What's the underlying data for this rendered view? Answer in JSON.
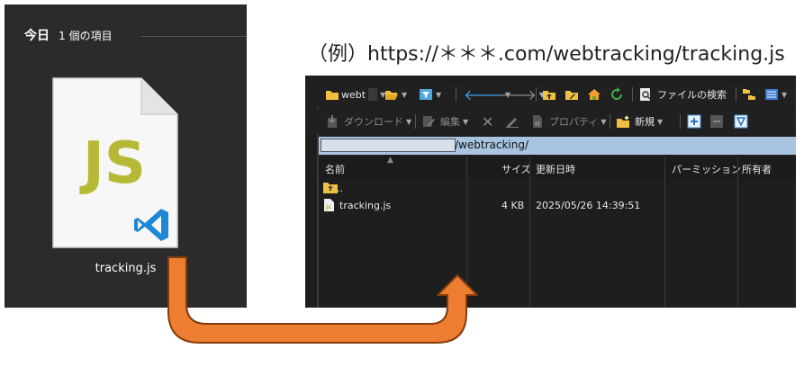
{
  "explorer": {
    "group_today": "今日",
    "group_count": "1 個の項目",
    "file_name": "tracking.js",
    "file_icon_text": "JS"
  },
  "annotation": {
    "text": "（例）https://＊＊＊.com/webtracking/tracking.js"
  },
  "ftp": {
    "toolbar1": {
      "site_label": "webt",
      "file_search_label": "ファイルの検索"
    },
    "toolbar2": {
      "download_label": "ダウンロード",
      "edit_label": "編集",
      "properties_label": "プロパティ",
      "new_label": "新規"
    },
    "address": {
      "path": "/webtracking/"
    },
    "columns": [
      "名前",
      "サイズ",
      "更新日時",
      "パーミッション",
      "所有者"
    ],
    "rows": [
      {
        "name": "..",
        "size": "",
        "modified": ""
      },
      {
        "name": "tracking.js",
        "size": "4 KB",
        "modified": "2025/05/26 14:39:51"
      }
    ]
  },
  "colors": {
    "arrow_fill": "#ed7d31",
    "arrow_stroke": "#843c0c",
    "explorer_bg": "#2b2b2b",
    "ftp_bg": "#1e1e1e",
    "address_bg": "#a8c4e0",
    "js_yellow": "#b5b935",
    "vscode_blue": "#1e88d6"
  }
}
